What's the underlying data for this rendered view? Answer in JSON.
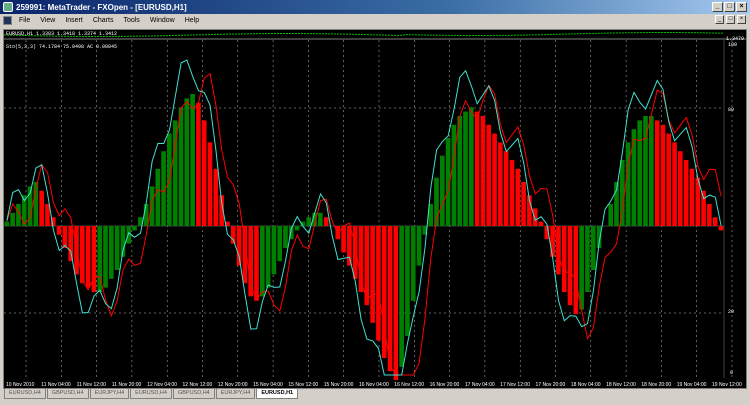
{
  "window": {
    "title": "259991: MetaTrader - FXOpen - [EURUSD,H1]",
    "min": "_",
    "max": "□",
    "close": "×"
  },
  "menu": [
    "File",
    "View",
    "Insert",
    "Charts",
    "Tools",
    "Window",
    "Help"
  ],
  "main_chart": {
    "info": "EURUSD,H1  1.3383 1.3418 1.3374 1.3412",
    "price_label": "1.3479"
  },
  "indicator": {
    "info": "Sto(5,3,3) 74.1784 75.0498   AC 0.00845",
    "levels": [
      "100",
      "80",
      "20",
      "0"
    ]
  },
  "time_axis": [
    "10 Nov 2010",
    "11 Nov 04:00",
    "11 Nov 12:00",
    "11 Nov 20:00",
    "12 Nov 04:00",
    "12 Nov 12:00",
    "12 Nov 20:00",
    "15 Nov 04:00",
    "15 Nov 12:00",
    "15 Nov 20:00",
    "16 Nov 04:00",
    "16 Nov 12:00",
    "16 Nov 20:00",
    "17 Nov 04:00",
    "17 Nov 12:00",
    "17 Nov 20:00",
    "18 Nov 04:00",
    "18 Nov 12:00",
    "18 Nov 20:00",
    "19 Nov 04:00",
    "19 Nov 12:00"
  ],
  "tabs": [
    "EURUSD,H4",
    "GBPUSD,H4",
    "EURJPY,H4",
    "EURUSD,H4",
    "GBPUSD,H4",
    "EURJPY,H4",
    "EURUSD,H1"
  ],
  "active_tab": 6,
  "colors": {
    "up": "#008000",
    "down": "#ff0000",
    "stoch_main": "#40e0d0",
    "stoch_signal": "#ff0000"
  },
  "ac_pattern": [
    2,
    6,
    10,
    14,
    18,
    20,
    16,
    10,
    4,
    -4,
    -10,
    -16,
    -22,
    -26,
    -28,
    -30,
    -30,
    -28,
    -24,
    -20,
    -14,
    -8,
    -2,
    4,
    10,
    18,
    26,
    34,
    42,
    48,
    54,
    58,
    60,
    56,
    48,
    38,
    26,
    14,
    2,
    -8,
    -18,
    -26,
    -32,
    -34,
    -32,
    -28,
    -22,
    -16,
    -10,
    -6,
    -2,
    2,
    4,
    6,
    6,
    4,
    0,
    -6,
    -12,
    -18,
    -24,
    -30,
    -36,
    -44,
    -52,
    -60,
    -66,
    -70,
    -64,
    -50,
    -34,
    -18,
    -4,
    10,
    22,
    32,
    40,
    46,
    50,
    52,
    54,
    52,
    50,
    46,
    42,
    38,
    34,
    30,
    26,
    20,
    14,
    8,
    2,
    -6,
    -14,
    -22,
    -30,
    -36,
    -40,
    -38,
    -30,
    -20,
    -10,
    0,
    10,
    20,
    30,
    38,
    44,
    48,
    50,
    50,
    48,
    46,
    42,
    38,
    34,
    30,
    26,
    22,
    16,
    10,
    4,
    -2
  ]
}
